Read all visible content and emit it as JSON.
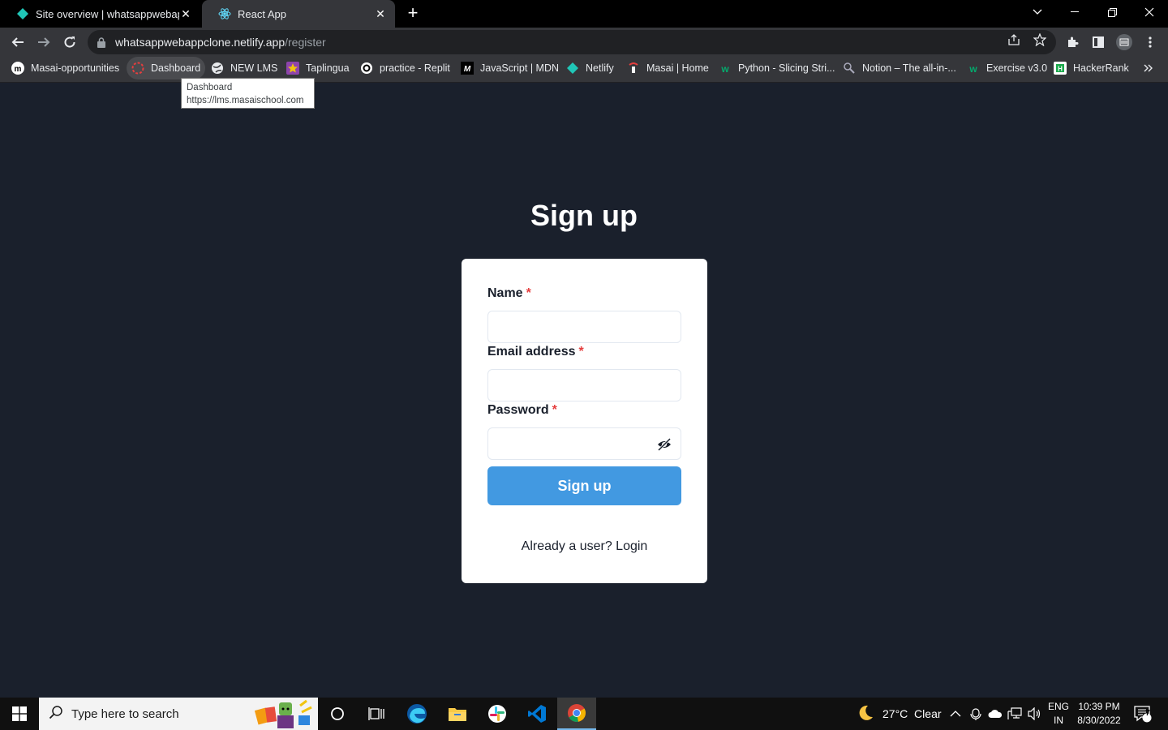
{
  "browser": {
    "tabs": [
      {
        "title": "Site overview | whatsappwebapp",
        "icon": "netlify-icon"
      },
      {
        "title": "React App",
        "icon": "react-icon",
        "active": true
      }
    ],
    "address": {
      "host": "whatsappwebappclone.netlify.app",
      "path": "/register"
    },
    "bookmarks": [
      {
        "label": "Masai-opportunities",
        "icon": "masai-icon"
      },
      {
        "label": "Dashboard",
        "icon": "dashboard-icon"
      },
      {
        "label": "NEW LMS",
        "icon": "globe-icon"
      },
      {
        "label": "Taplingua",
        "icon": "star-icon"
      },
      {
        "label": "practice - Replit",
        "icon": "replit-icon"
      },
      {
        "label": "JavaScript | MDN",
        "icon": "mdn-icon"
      },
      {
        "label": "Netlify",
        "icon": "netlify-icon"
      },
      {
        "label": "Masai | Home",
        "icon": "masai-home-icon"
      },
      {
        "label": "Python - Slicing Stri...",
        "icon": "w3-icon"
      },
      {
        "label": "Notion – The all-in-...",
        "icon": "notion-icon"
      },
      {
        "label": "Exercise v3.0",
        "icon": "w3-icon"
      },
      {
        "label": "HackerRank",
        "icon": "hackerrank-icon"
      }
    ],
    "tooltip": {
      "title": "Dashboard",
      "url": "https://lms.masaischool.com"
    }
  },
  "form": {
    "heading": "Sign up",
    "name_label": "Name",
    "email_label": "Email address",
    "password_label": "Password",
    "required_mark": "*",
    "submit_label": "Sign up",
    "login_link": "Already a user? Login"
  },
  "taskbar": {
    "search_placeholder": "Type here to search",
    "weather": "27°C  Clear",
    "lang_top": "ENG",
    "lang_bottom": "IN",
    "time": "10:39 PM",
    "date": "8/30/2022",
    "notification_count": "7"
  },
  "colors": {
    "page_bg": "#1a202c",
    "button": "#4299e1",
    "required": "#e53e3e"
  }
}
